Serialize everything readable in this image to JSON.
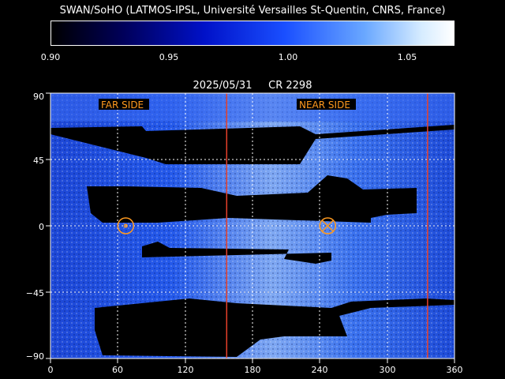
{
  "title": "SWAN/SoHO (LATMOS-IPSL, Université Versailles St-Quentin, CNRS, France)",
  "colorbar": {
    "ticks": [
      "0.90",
      "0.95",
      "1.00",
      "1.05"
    ],
    "range": [
      0.9,
      1.07
    ]
  },
  "header": {
    "date": "2025/05/31",
    "rotation": "CR 2298"
  },
  "labels": {
    "far_side": "FAR SIDE",
    "near_side": "NEAR SIDE"
  },
  "colors": {
    "marker": "#ff9a1f",
    "meridian": "#e8402a",
    "grid": "#ffffff",
    "frame": "#ffffff"
  },
  "chart_data": {
    "type": "heatmap",
    "x_ticks": [
      "0",
      "60",
      "120",
      "180",
      "240",
      "300",
      "360"
    ],
    "y_ticks": [
      "90",
      "45",
      "0",
      "−45",
      "−90"
    ],
    "xlim": [
      0,
      360
    ],
    "ylim": [
      -90,
      90
    ],
    "grid": true,
    "vertical_lines_longitude": [
      157,
      336
    ],
    "far_side_marker": {
      "lon": 67,
      "lat": 0
    },
    "near_side_marker": {
      "lon": 247,
      "lat": 0
    }
  }
}
